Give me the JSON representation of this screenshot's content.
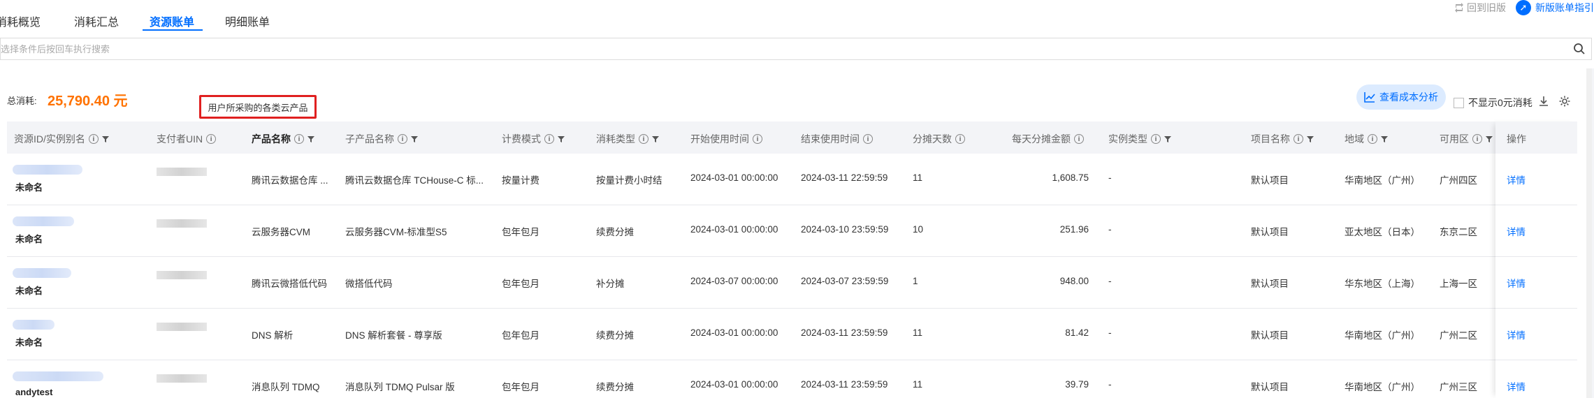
{
  "tabs": [
    {
      "label": "消耗概览",
      "active": false
    },
    {
      "label": "消耗汇总",
      "active": false
    },
    {
      "label": "资源账单",
      "active": true
    },
    {
      "label": "明细账单",
      "active": false
    }
  ],
  "top_links": {
    "old_version": "回到旧版",
    "guide": "新版账单指引"
  },
  "search": {
    "placeholder": "选择条件后按回车执行搜索"
  },
  "summary": {
    "label": "总消耗:",
    "value": "25,790.40 元"
  },
  "tooltip": "用户所采购的各类云产品",
  "toolbar": {
    "cost_analysis": "查看成本分析",
    "hide_zero": "不显示0元消耗"
  },
  "columns": [
    {
      "label": "资源ID/实例别名",
      "info": true,
      "filter": true
    },
    {
      "label": "支付者UIN",
      "info": true,
      "filter": false
    },
    {
      "label": "产品名称",
      "info": true,
      "filter": true,
      "strong": true
    },
    {
      "label": "子产品名称",
      "info": true,
      "filter": true
    },
    {
      "label": "计费模式",
      "info": true,
      "filter": true
    },
    {
      "label": "消耗类型",
      "info": true,
      "filter": true
    },
    {
      "label": "开始使用时间",
      "info": true,
      "filter": false
    },
    {
      "label": "结束使用时间",
      "info": true,
      "filter": false
    },
    {
      "label": "分摊天数",
      "info": true,
      "filter": false
    },
    {
      "label": "每天分摊金额",
      "info": true,
      "filter": false
    },
    {
      "label": "实例类型",
      "info": true,
      "filter": true
    },
    {
      "label": "项目名称",
      "info": true,
      "filter": true
    },
    {
      "label": "地域",
      "info": true,
      "filter": true
    },
    {
      "label": "可用区",
      "info": true,
      "filter": true
    },
    {
      "label": "操作",
      "info": false,
      "filter": false
    }
  ],
  "rows": [
    {
      "name": "未命名",
      "product": "腾讯云数据仓库 ...",
      "sub_product": "腾讯云数据仓库 TCHouse-C 标...",
      "billing": "按量计费",
      "consume_type": "按量计费小时结",
      "start": "2024-03-01 00:00:00",
      "end": "2024-03-11 22:59:59",
      "days": "11",
      "daily": "1,608.75",
      "inst_type": "-",
      "project": "默认项目",
      "region": "华南地区（广州）",
      "zone": "广州四区",
      "action": "详情"
    },
    {
      "name": "未命名",
      "product": "云服务器CVM",
      "sub_product": "云服务器CVM-标准型S5",
      "billing": "包年包月",
      "consume_type": "续费分摊",
      "start": "2024-03-01 00:00:00",
      "end": "2024-03-10 23:59:59",
      "days": "10",
      "daily": "251.96",
      "inst_type": "-",
      "project": "默认项目",
      "region": "亚太地区（日本）",
      "zone": "东京二区",
      "action": "详情"
    },
    {
      "name": "未命名",
      "product": "腾讯云微搭低代码",
      "sub_product": "微搭低代码",
      "billing": "包年包月",
      "consume_type": "补分摊",
      "start": "2024-03-07 00:00:00",
      "end": "2024-03-07 23:59:59",
      "days": "1",
      "daily": "948.00",
      "inst_type": "-",
      "project": "默认项目",
      "region": "华东地区（上海）",
      "zone": "上海一区",
      "action": "详情"
    },
    {
      "name": "未命名",
      "product": "DNS 解析",
      "sub_product": "DNS 解析套餐 - 尊享版",
      "billing": "包年包月",
      "consume_type": "续费分摊",
      "start": "2024-03-01 00:00:00",
      "end": "2024-03-11 23:59:59",
      "days": "11",
      "daily": "81.42",
      "inst_type": "-",
      "project": "默认项目",
      "region": "华南地区（广州）",
      "zone": "广州二区",
      "action": "详情"
    },
    {
      "name": "andytest",
      "product": "消息队列 TDMQ",
      "sub_product": "消息队列 TDMQ Pulsar 版",
      "billing": "包年包月",
      "consume_type": "续费分摊",
      "start": "2024-03-01 00:00:00",
      "end": "2024-03-11 23:59:59",
      "days": "11",
      "daily": "39.79",
      "inst_type": "-",
      "project": "默认项目",
      "region": "华南地区（广州）",
      "zone": "广州三区",
      "action": "详情"
    }
  ],
  "colors": {
    "accent": "#006eff",
    "total": "#ff7200",
    "highlight_border": "#e02020"
  },
  "icons": [
    "refresh-icon",
    "guide-icon",
    "search-icon",
    "chart-icon",
    "download-icon",
    "gear-icon",
    "info-icon",
    "filter-icon"
  ]
}
